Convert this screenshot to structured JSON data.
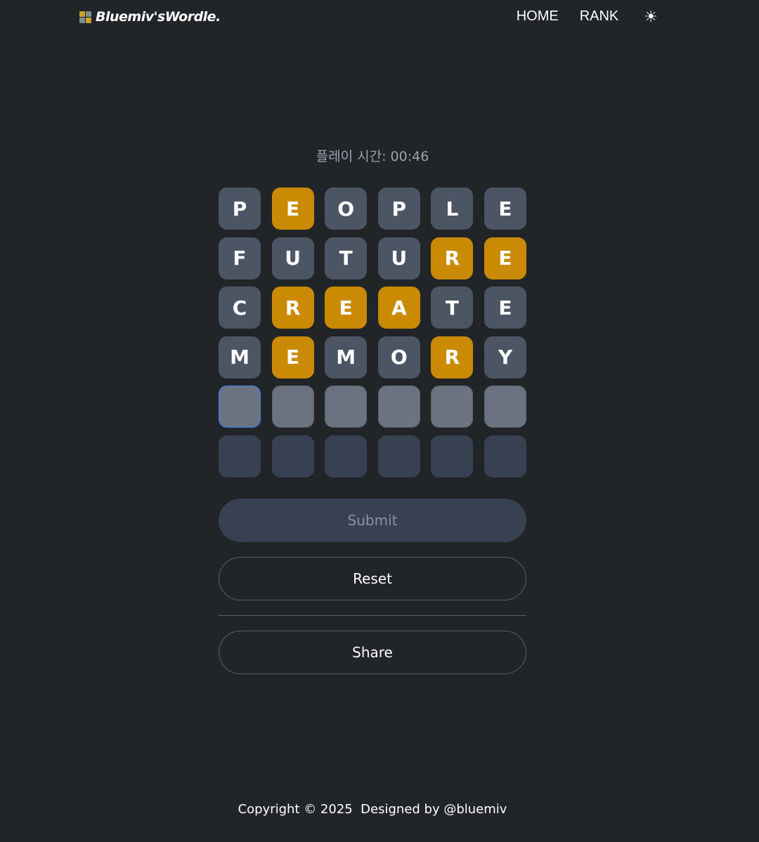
{
  "header": {
    "title": "Bluemiv'sWordle.",
    "logo_icon": "wordle-grid-logo",
    "logo_colors": [
      "#c9a227",
      "#7f8c8d",
      "#7f8c8d",
      "#c9a227"
    ],
    "nav": [
      {
        "label": "HOME"
      },
      {
        "label": "RANK"
      }
    ],
    "theme_icon": "☀",
    "theme_icon_name": "sun-icon"
  },
  "timer": {
    "text": "플레이 시간: 00:46"
  },
  "colors": {
    "background": "#222528",
    "absent": "#4b5563",
    "present": "#ca8a04",
    "input": "#6b7280",
    "empty": "#374151",
    "active_border": "#3b82f6"
  },
  "board": {
    "rows": [
      [
        {
          "letter": "P",
          "state": "absent"
        },
        {
          "letter": "E",
          "state": "present"
        },
        {
          "letter": "O",
          "state": "absent"
        },
        {
          "letter": "P",
          "state": "absent"
        },
        {
          "letter": "L",
          "state": "absent"
        },
        {
          "letter": "E",
          "state": "absent"
        }
      ],
      [
        {
          "letter": "F",
          "state": "absent"
        },
        {
          "letter": "U",
          "state": "absent"
        },
        {
          "letter": "T",
          "state": "absent"
        },
        {
          "letter": "U",
          "state": "absent"
        },
        {
          "letter": "R",
          "state": "present"
        },
        {
          "letter": "E",
          "state": "present"
        }
      ],
      [
        {
          "letter": "C",
          "state": "absent"
        },
        {
          "letter": "R",
          "state": "present"
        },
        {
          "letter": "E",
          "state": "present"
        },
        {
          "letter": "A",
          "state": "present"
        },
        {
          "letter": "T",
          "state": "absent"
        },
        {
          "letter": "E",
          "state": "absent"
        }
      ],
      [
        {
          "letter": "M",
          "state": "absent"
        },
        {
          "letter": "E",
          "state": "present"
        },
        {
          "letter": "M",
          "state": "absent"
        },
        {
          "letter": "O",
          "state": "absent"
        },
        {
          "letter": "R",
          "state": "present"
        },
        {
          "letter": "Y",
          "state": "absent"
        }
      ],
      [
        {
          "letter": "",
          "state": "input active"
        },
        {
          "letter": "",
          "state": "input"
        },
        {
          "letter": "",
          "state": "input"
        },
        {
          "letter": "",
          "state": "input"
        },
        {
          "letter": "",
          "state": "input"
        },
        {
          "letter": "",
          "state": "input"
        }
      ],
      [
        {
          "letter": "",
          "state": "empty"
        },
        {
          "letter": "",
          "state": "empty"
        },
        {
          "letter": "",
          "state": "empty"
        },
        {
          "letter": "",
          "state": "empty"
        },
        {
          "letter": "",
          "state": "empty"
        },
        {
          "letter": "",
          "state": "empty"
        }
      ]
    ]
  },
  "buttons": {
    "submit": "Submit",
    "reset": "Reset",
    "share": "Share"
  },
  "footer": {
    "text": "Copyright © 2025  Designed by @bluemiv"
  }
}
